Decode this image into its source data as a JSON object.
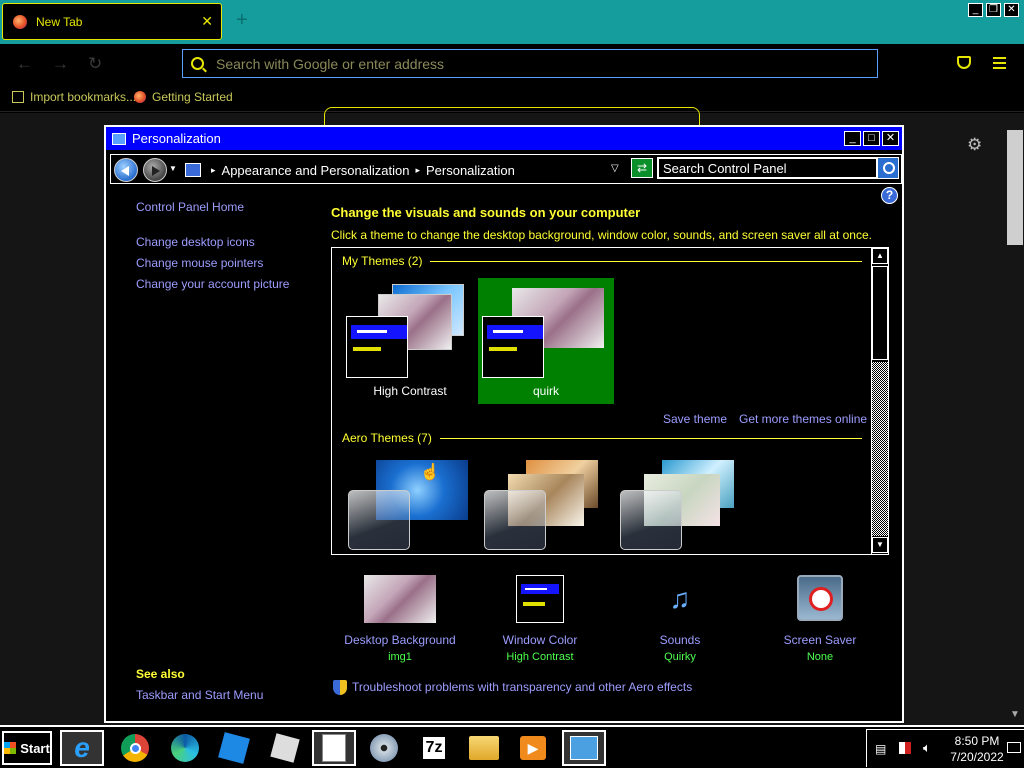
{
  "browser": {
    "tab_title": "New Tab",
    "tab_close": "✕",
    "new_tab": "+",
    "window_controls": [
      "_",
      "❐",
      "✕"
    ],
    "url_placeholder": "Search with Google or enter address",
    "bookmarks": [
      "Import bookmarks...",
      "Getting Started"
    ],
    "icons": [
      "back-icon",
      "forward-icon",
      "reload-icon",
      "pocket-icon",
      "menu-icon",
      "gear-icon",
      "firefox-icon"
    ]
  },
  "window": {
    "title": "Personalization",
    "controls": [
      "_",
      "□",
      "✕"
    ],
    "breadcrumbs": [
      "Appearance and Personalization",
      "Personalization"
    ],
    "search_value": "Search Control Panel",
    "help": "?",
    "accent_title_bar": "#0000ff",
    "heading_color": "#ffff33",
    "link_color": "#9d9dff"
  },
  "sidebar": {
    "home": "Control Panel Home",
    "links": [
      "Change desktop icons",
      "Change mouse pointers",
      "Change your account picture"
    ],
    "see_also_title": "See also",
    "see_also_links": [
      "Taskbar and Start Menu"
    ]
  },
  "main": {
    "heading": "Change the visuals and sounds on your computer",
    "subheading": "Click a theme to change the desktop background, window color, sounds, and screen saver all at once.",
    "my_themes_header": "My Themes (2)",
    "my_themes": [
      {
        "name": "High Contrast",
        "selected": false
      },
      {
        "name": "quirk",
        "selected": true
      }
    ],
    "save_theme": "Save theme",
    "get_more": "Get more themes online",
    "aero_header": "Aero Themes (7)",
    "selected_color": "#008000"
  },
  "bottom": {
    "items": [
      {
        "title": "Desktop Background",
        "value": "img1",
        "icon": "wallpaper-icon"
      },
      {
        "title": "Window Color",
        "value": "High Contrast",
        "icon": "window-color-icon"
      },
      {
        "title": "Sounds",
        "value": "Quirky",
        "icon": "music-notes-icon"
      },
      {
        "title": "Screen Saver",
        "value": "None",
        "icon": "screen-saver-icon"
      }
    ],
    "troubleshoot": "Troubleshoot problems with transparency and other Aero effects"
  },
  "taskbar": {
    "start": "Start",
    "apps": [
      "internet-explorer-icon",
      "chrome-icon",
      "edge-icon",
      "roblox-studio-icon",
      "roblox-icon",
      "notepad-icon",
      "dvd-icon",
      "7zip-icon",
      "file-explorer-icon",
      "media-player-icon",
      "control-panel-icon"
    ],
    "seven_zip_label": "7z",
    "clock_time": "8:50 PM",
    "clock_date": "7/20/2022"
  }
}
